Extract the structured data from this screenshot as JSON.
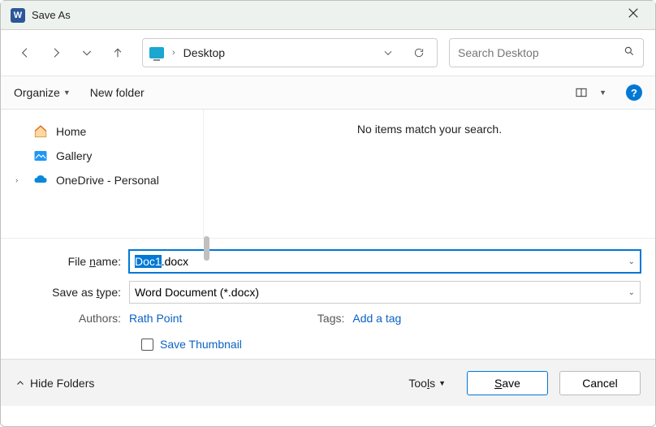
{
  "titlebar": {
    "title": "Save As"
  },
  "nav": {
    "location": "Desktop",
    "search_placeholder": "Search Desktop"
  },
  "toolbar": {
    "organize": "Organize",
    "new_folder": "New folder"
  },
  "sidebar": {
    "items": [
      {
        "label": "Home"
      },
      {
        "label": "Gallery"
      },
      {
        "label": "OneDrive - Personal"
      }
    ]
  },
  "content": {
    "empty_message": "No items match your search."
  },
  "form": {
    "filename_label": "File name:",
    "filename_selected": "Doc1",
    "filename_rest": ".docx",
    "type_label": "Save as type:",
    "type_value": "Word Document (*.docx)",
    "authors_label": "Authors:",
    "authors_value": "Rath Point",
    "tags_label": "Tags:",
    "tags_value": "Add a tag",
    "thumbnail_label": "Save Thumbnail"
  },
  "footer": {
    "hide_folders": "Hide Folders",
    "tools": "Tools",
    "save": "Save",
    "cancel": "Cancel"
  }
}
